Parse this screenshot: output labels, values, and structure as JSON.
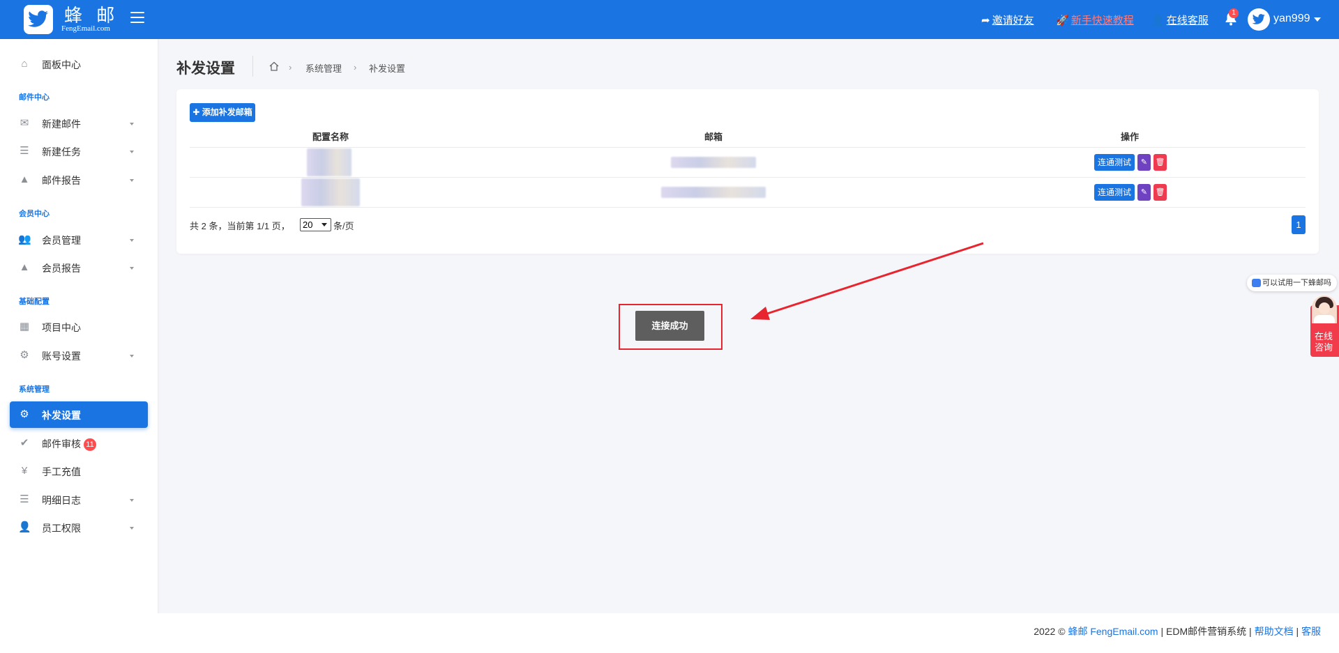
{
  "header": {
    "logo_cn": "蜂 邮",
    "logo_en": "FengEmail.com",
    "links": {
      "invite": "邀请好友",
      "tutorial": "新手快速教程",
      "support": "在线客服"
    },
    "notification_count": "1",
    "username": "yan999"
  },
  "sidebar": {
    "dashboard": "面板中心",
    "sections": {
      "mail": "邮件中心",
      "member": "会员中心",
      "base": "基础配置",
      "system": "系统管理"
    },
    "items": {
      "new_mail": "新建邮件",
      "new_task": "新建任务",
      "mail_report": "邮件报告",
      "member_manage": "会员管理",
      "member_report": "会员报告",
      "project_center": "项目中心",
      "account_settings": "账号设置",
      "resend_settings": "补发设置",
      "mail_review": "邮件审核",
      "mail_review_count": "11",
      "manual_recharge": "手工充值",
      "detail_log": "明细日志",
      "staff_permission": "员工权限"
    }
  },
  "page": {
    "title": "补发设置",
    "breadcrumb": [
      "系统管理",
      "补发设置"
    ],
    "add_button": "添加补发邮箱",
    "table": {
      "headers": [
        "配置名称",
        "邮箱",
        "操作"
      ],
      "row_action_label": "连通测试"
    },
    "pager": {
      "summary": "共 2 条，当前第 1/1 页，",
      "page_size": "20",
      "unit": "条/页",
      "current_page": "1"
    },
    "toast": "连接成功"
  },
  "chat": {
    "bubble": "可以试用一下蜂邮吗",
    "tab_line1": "在线",
    "tab_line2": "咨询"
  },
  "footer": {
    "year": "2022 ©",
    "brand": "蜂邮 FengEmail.com",
    "system": "EDM邮件营销系统",
    "help": "帮助文档",
    "service": "客服",
    "sep": "|"
  },
  "colors": {
    "primary": "#1a74e2",
    "danger": "#ef3b4f",
    "purple": "#6f42c1",
    "highlight_red": "#e8242e"
  }
}
